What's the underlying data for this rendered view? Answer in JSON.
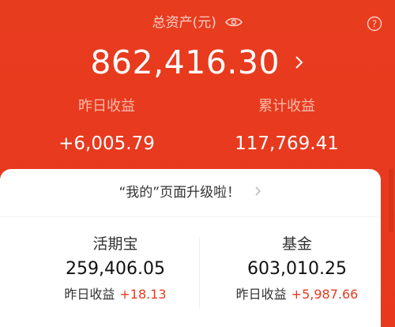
{
  "header": {
    "total_label": "总资产(元)",
    "total_value": "862,416.30",
    "yesterday_label": "昨日收益",
    "yesterday_value": "+6,005.79",
    "cumulative_label": "累计收益",
    "cumulative_value": "117,769.41"
  },
  "notice": {
    "text": "“我的”页面升级啦！"
  },
  "funds": [
    {
      "name": "活期宝",
      "value": "259,406.05",
      "yesterday_label": "昨日收益",
      "yesterday_change": "+18.13"
    },
    {
      "name": "基金",
      "value": "603,010.25",
      "yesterday_label": "昨日收益",
      "yesterday_change": "+5,987.66"
    }
  ],
  "colors": {
    "background": "#e8391e",
    "positive": "#e8391e"
  },
  "icons": {
    "eye": "eye-icon",
    "help": "help-icon",
    "chevron_total": "chevron-right-icon",
    "chevron_notice": "chevron-right-icon"
  }
}
